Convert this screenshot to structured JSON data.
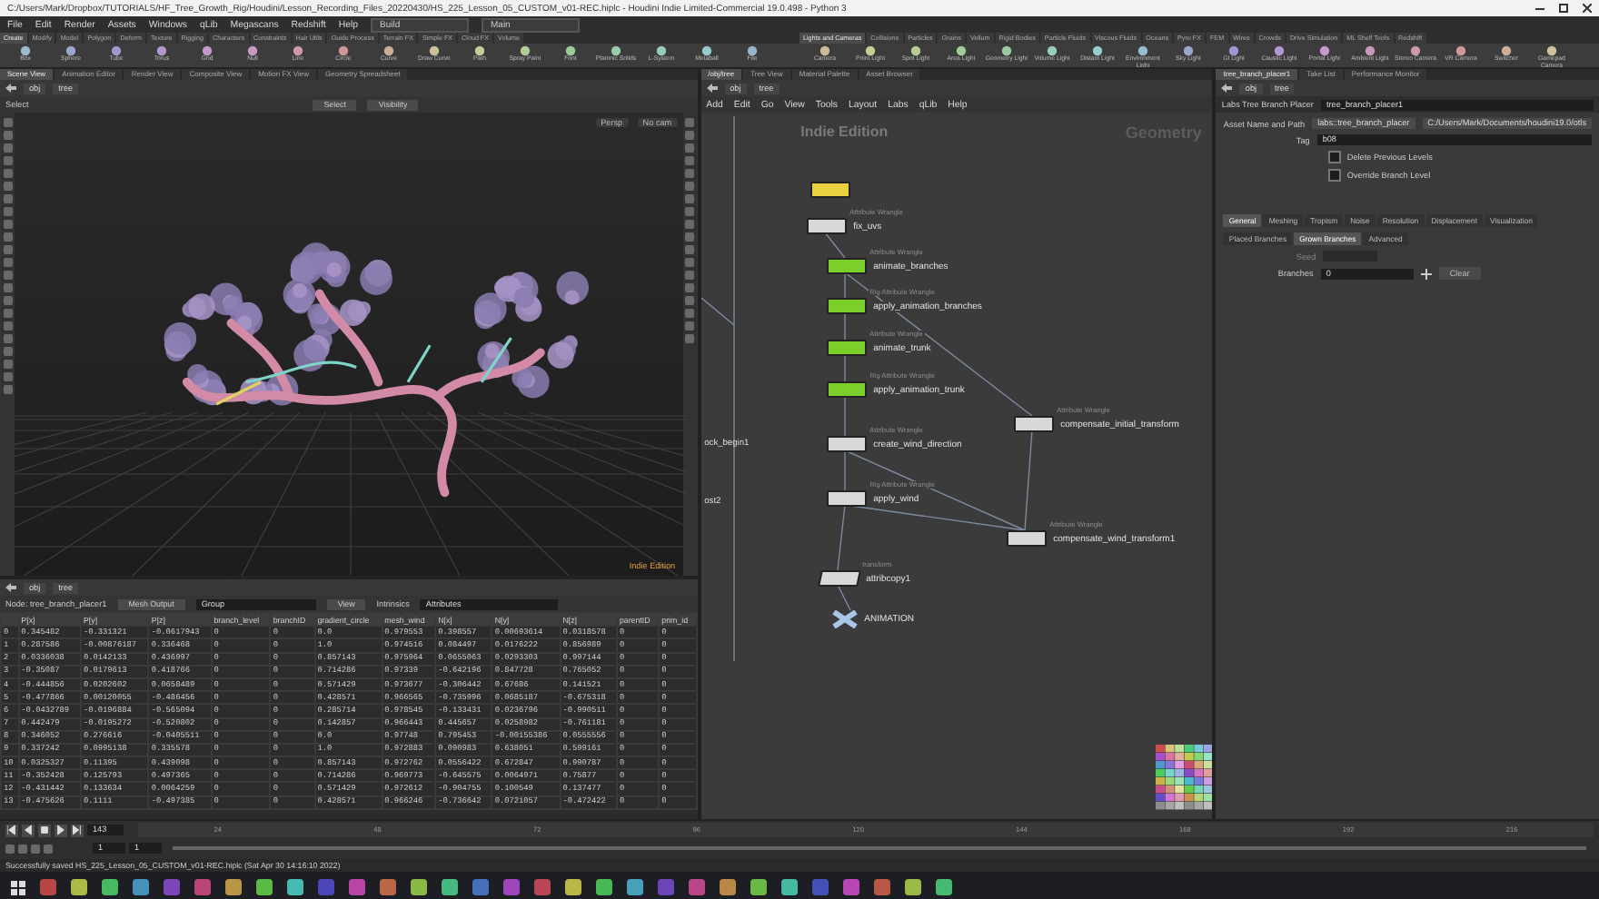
{
  "window": {
    "title": "C:/Users/Mark/Dropbox/TUTORIALS/HF_Tree_Growth_Rig/Houdini/Lesson_Recording_Files_20220430/HS_225_Lesson_05_CUSTOM_v01-REC.hiplc - Houdini Indie Limited-Commercial 19.0.498 - Python 3"
  },
  "menu_bar": {
    "items": [
      "File",
      "Edit",
      "Render",
      "Assets",
      "Windows",
      "qLib",
      "Megascans",
      "Redshift",
      "Help"
    ],
    "desktop": "Build",
    "desktop_2": "Main"
  },
  "shelf_left": {
    "tabs": [
      {
        "label": "Create",
        "selected": true
      },
      {
        "label": "Modify",
        "selected": false
      },
      {
        "label": "Model",
        "selected": false
      },
      {
        "label": "Polygon",
        "selected": false
      },
      {
        "label": "Deform",
        "selected": false
      },
      {
        "label": "Texture",
        "selected": false
      },
      {
        "label": "Rigging",
        "selected": false
      },
      {
        "label": "Characters",
        "selected": false
      },
      {
        "label": "Constraints",
        "selected": false
      },
      {
        "label": "Hair Utils",
        "selected": false
      },
      {
        "label": "Guide Process",
        "selected": false
      },
      {
        "label": "Terrain FX",
        "selected": false
      },
      {
        "label": "Simple FX",
        "selected": false
      },
      {
        "label": "Cloud FX",
        "selected": false
      },
      {
        "label": "Volume",
        "selected": false
      }
    ],
    "tools": [
      "Box",
      "Sphere",
      "Tube",
      "Torus",
      "Grid",
      "Null",
      "Line",
      "Circle",
      "Curve",
      "Draw Curve",
      "Path",
      "Spray Paint",
      "Font",
      "Platonic Solids",
      "L-System",
      "Metaball",
      "File"
    ]
  },
  "shelf_right": {
    "tabs": [
      {
        "label": "Lights and Cameras",
        "selected": true
      },
      {
        "label": "Collisions",
        "selected": false
      },
      {
        "label": "Particles",
        "selected": false
      },
      {
        "label": "Grains",
        "selected": false
      },
      {
        "label": "Vellum",
        "selected": false
      },
      {
        "label": "Rigid Bodies",
        "selected": false
      },
      {
        "label": "Particle Fluids",
        "selected": false
      },
      {
        "label": "Viscous Fluids",
        "selected": false
      },
      {
        "label": "Oceans",
        "selected": false
      },
      {
        "label": "Pyro FX",
        "selected": false
      },
      {
        "label": "FEM",
        "selected": false
      },
      {
        "label": "Wires",
        "selected": false
      },
      {
        "label": "Crowds",
        "selected": false
      },
      {
        "label": "Drive Simulation",
        "selected": false
      },
      {
        "label": "ML Shelf Tools",
        "selected": false
      },
      {
        "label": "Redshift",
        "selected": false
      }
    ],
    "tools": [
      "Camera",
      "Point Light",
      "Spot Light",
      "Area Light",
      "Geometry Light",
      "Volume Light",
      "Distant Light",
      "Environment Light",
      "Sky Light",
      "GI Light",
      "Caustic Light",
      "Portal Light",
      "Ambient Light",
      "Stereo Camera",
      "VR Camera",
      "Switcher",
      "Gamepad Camera"
    ]
  },
  "viewport_pane": {
    "tabs": [
      {
        "label": "Scene View",
        "selected": true
      },
      {
        "label": "Animation Editor",
        "selected": false
      },
      {
        "label": "Render View",
        "selected": false
      },
      {
        "label": "Composite View",
        "selected": false
      },
      {
        "label": "Motion FX View",
        "selected": false
      },
      {
        "label": "Geometry Spreadsheet",
        "selected": false
      }
    ],
    "path": [
      "obj",
      "tree"
    ],
    "select_tool": "Select",
    "select_mode": "Select",
    "visibility": "Visibility",
    "camera": "Persp",
    "camera_2": "No cam",
    "edition": "Indie Edition"
  },
  "spreadsheet": {
    "path": [
      "obj",
      "tree"
    ],
    "node": "Node: tree_branch_placer1",
    "output": "Mesh Output",
    "group": "Group",
    "view": "View",
    "intrinsics": "Intrinsics",
    "attributes": "Attributes",
    "columns": [
      "",
      "P[x]",
      "P[y]",
      "P[z]",
      "branch_level",
      "branchID",
      "gradient_circle",
      "mesh_wind",
      "N[x]",
      "N[y]",
      "N[z]",
      "parentID",
      "prim_id"
    ],
    "rows": [
      [
        "0",
        "0.345482",
        "-0.331321",
        "-0.0617943",
        "0",
        "0",
        "0.0",
        "0.979553",
        "0.398557",
        "0.00693614",
        "0.0318578",
        "0",
        "0"
      ],
      [
        "1",
        "0.287586",
        "-0.00876187",
        "0.336468",
        "0",
        "0",
        "1.0",
        "0.974516",
        "0.084497",
        "0.0176222",
        "0.856989",
        "0",
        "0"
      ],
      [
        "2",
        "0.0336038",
        "0.0142133",
        "0.436997",
        "0",
        "0",
        "0.857143",
        "0.975964",
        "0.0655063",
        "0.0293303",
        "0.997144",
        "0",
        "0"
      ],
      [
        "3",
        "-0.35087",
        "0.0179613",
        "0.418766",
        "0",
        "0",
        "0.714286",
        "0.97339",
        "-0.642196",
        "0.847728",
        "0.765052",
        "0",
        "0"
      ],
      [
        "4",
        "-0.444856",
        "0.0202602",
        "0.0658489",
        "0",
        "0",
        "0.571429",
        "0.973677",
        "-0.306442",
        "0.67686",
        "0.141521",
        "0",
        "0"
      ],
      [
        "5",
        "-0.477866",
        "0.00120055",
        "-0.486456",
        "0",
        "0",
        "0.428571",
        "0.966565",
        "-0.735996",
        "0.0685187",
        "-0.675318",
        "0",
        "0"
      ],
      [
        "6",
        "-0.0432789",
        "-0.0196884",
        "-0.565094",
        "0",
        "0",
        "0.285714",
        "0.978545",
        "-0.133431",
        "0.0236796",
        "-0.990511",
        "0",
        "0"
      ],
      [
        "7",
        "0.442479",
        "-0.0195272",
        "-0.520802",
        "0",
        "0",
        "0.142857",
        "0.966443",
        "0.445657",
        "0.0258982",
        "-0.761181",
        "0",
        "0"
      ],
      [
        "8",
        "0.346052",
        "0.276616",
        "-0.0405511",
        "0",
        "0",
        "0.0",
        "0.97748",
        "0.795453",
        "-0.00155386",
        "0.0555556",
        "0",
        "0"
      ],
      [
        "9",
        "0.337242",
        "0.0995138",
        "0.335578",
        "0",
        "0",
        "1.0",
        "0.972883",
        "0.090983",
        "0.638051",
        "0.599161",
        "0",
        "0"
      ],
      [
        "10",
        "0.0325327",
        "0.11395",
        "0.439098",
        "0",
        "0",
        "0.857143",
        "0.972762",
        "0.0556422",
        "0.672847",
        "0.990787",
        "0",
        "0"
      ],
      [
        "11",
        "-0.352428",
        "0.125793",
        "0.497365",
        "0",
        "0",
        "0.714286",
        "0.969773",
        "-0.645575",
        "0.0064971",
        "0.75877",
        "0",
        "0"
      ],
      [
        "12",
        "-0.431442",
        "0.133634",
        "0.0064259",
        "0",
        "0",
        "0.571429",
        "0.972612",
        "-0.904755",
        "0.100549",
        "0.137477",
        "0",
        "0"
      ],
      [
        "13",
        "-0.475626",
        "0.1111",
        "-0.497385",
        "0",
        "0",
        "0.428571",
        "0.966246",
        "-0.736642",
        "0.0721057",
        "-0.472422",
        "0",
        "0"
      ]
    ]
  },
  "network": {
    "tabs": [
      {
        "label": "/obj/tree",
        "selected": true
      },
      {
        "label": "Tree View",
        "selected": false
      },
      {
        "label": "Material Palette",
        "selected": false
      },
      {
        "label": "Asset Browser",
        "selected": false
      }
    ],
    "path": [
      "obj",
      "tree"
    ],
    "menus": [
      "Add",
      "Edit",
      "Go",
      "View",
      "Tools",
      "Layout",
      "Labs",
      "qLib",
      "Help"
    ],
    "watermark": "Indie Edition",
    "context": "Geometry",
    "side_labels": [
      "ock_begin1",
      "ost2"
    ],
    "nodes": [
      {
        "name": "fix_uvs",
        "type": "Attribute Wrangle",
        "kind": "wrangle",
        "color": "#d8d8d8"
      },
      {
        "name": "animate_branches",
        "type": "Attribute Wrangle",
        "kind": "wrangle",
        "color": "#7ccf2a"
      },
      {
        "name": "apply_animation_branches",
        "type": "Rig Attribute Wrangle",
        "kind": "wrangle",
        "color": "#7ccf2a"
      },
      {
        "name": "animate_trunk",
        "type": "Attribute Wrangle",
        "kind": "wrangle",
        "color": "#7ccf2a"
      },
      {
        "name": "apply_animation_trunk",
        "type": "Rig Attribute Wrangle",
        "kind": "wrangle",
        "color": "#7ccf2a"
      },
      {
        "name": "create_wind_direction",
        "type": "Attribute Wrangle",
        "kind": "wrangle",
        "color": "#d8d8d8"
      },
      {
        "name": "apply_wind",
        "type": "Rig Attribute Wrangle",
        "kind": "wrangle",
        "color": "#d8d8d8"
      },
      {
        "name": "compensate_initial_transform",
        "type": "Attribute Wrangle",
        "kind": "wrangle",
        "color": "#d8d8d8"
      },
      {
        "name": "compensate_wind_transform1",
        "type": "Attribute Wrangle",
        "kind": "wrangle",
        "color": "#d8d8d8"
      },
      {
        "name": "attribcopy1",
        "type": "transform",
        "kind": "copy",
        "color": "#d8d8d8"
      },
      {
        "name": "ANIMATION",
        "kind": "null",
        "color": "#a9c6e8"
      }
    ]
  },
  "parameters": {
    "tabs": [
      {
        "label": "tree_branch_placer1",
        "selected": true
      },
      {
        "label": "Take List",
        "selected": false
      },
      {
        "label": "Performance Monitor",
        "selected": false
      }
    ],
    "path": [
      "obj",
      "tree"
    ],
    "asset_type": "Labs Tree Branch Placer",
    "node_name": "tree_branch_placer1",
    "asset_label": "Asset Name and Path",
    "asset_name": "labs::tree_branch_placer",
    "asset_path": "C:/Users/Mark/Documents/houdini19.0/otls",
    "tag_label": "Tag",
    "tag": "b08",
    "checkboxes": [
      {
        "label": "Delete Previous Levels",
        "checked": false
      },
      {
        "label": "Override Branch Level",
        "checked": false
      }
    ],
    "sections": [
      {
        "label": "General",
        "selected": true
      },
      {
        "label": "Meshing",
        "selected": false
      },
      {
        "label": "Tropism",
        "selected": false
      },
      {
        "label": "Noise",
        "selected": false
      },
      {
        "label": "Resolution",
        "selected": false
      },
      {
        "label": "Displacement",
        "selected": false
      },
      {
        "label": "Visualization",
        "selected": false
      }
    ],
    "subsections": [
      {
        "label": "Placed Branches",
        "selected": false
      },
      {
        "label": "Grown Branches",
        "selected": true
      },
      {
        "label": "Advanced",
        "selected": false
      }
    ],
    "seed_label": "Seed",
    "branches_label": "Branches",
    "branches": "0",
    "clear": "Clear"
  },
  "timeline": {
    "frame": "143",
    "start": "1",
    "end": "1",
    "range": {
      "level": 1.0
    },
    "ticks": [
      "24",
      "48",
      "72",
      "96",
      "120",
      "144",
      "168",
      "192",
      "216"
    ]
  },
  "status_bar": "Successfully saved HS_225_Lesson_05_CUSTOM_v01-REC.hiplc (Sat Apr 30 14:16:10 2022)"
}
